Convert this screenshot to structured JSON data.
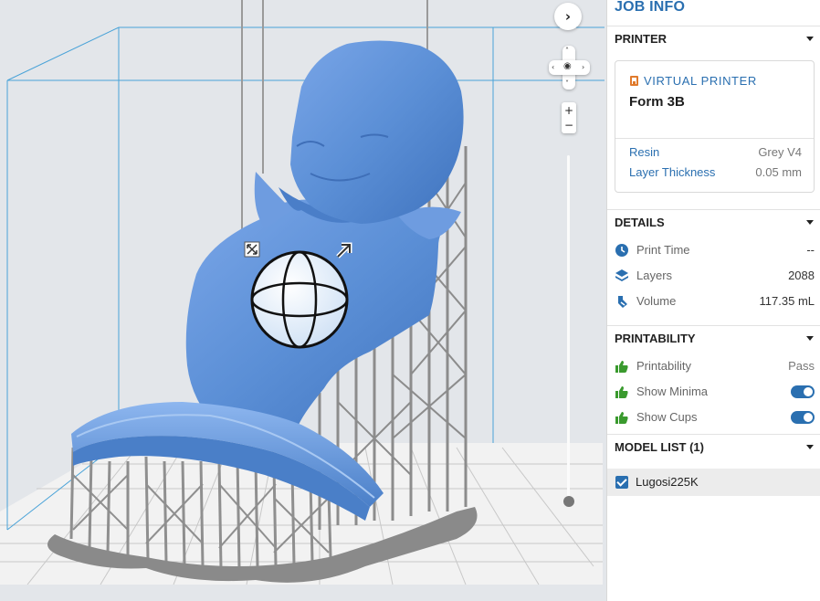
{
  "viewport": {
    "collapse_icon": "chevron-right-icon",
    "zoom_in": "+",
    "zoom_out": "−",
    "zoom_level": 0.05
  },
  "panel": {
    "title": "JOB INFO",
    "printer": {
      "header": "PRINTER",
      "virtual_label": "VIRTUAL PRINTER",
      "model": "Form 3B",
      "resin_label": "Resin",
      "resin_value": "Grey V4",
      "layer_label": "Layer Thickness",
      "layer_value": "0.05 mm"
    },
    "details": {
      "header": "DETAILS",
      "print_time_label": "Print Time",
      "print_time_value": "--",
      "layers_label": "Layers",
      "layers_value": "2088",
      "volume_label": "Volume",
      "volume_value": "117.35 mL"
    },
    "printability": {
      "header": "PRINTABILITY",
      "printability_label": "Printability",
      "printability_value": "Pass",
      "minima_label": "Show Minima",
      "minima_on": true,
      "cups_label": "Show Cups",
      "cups_on": true
    },
    "model_list": {
      "header": "MODEL LIST (1)",
      "items": [
        {
          "name": "Lugosi225K",
          "checked": true
        }
      ]
    }
  },
  "colors": {
    "accent": "#2a6fb0",
    "model_blue": "#5b8fd6",
    "support_grey": "#9a9a9a",
    "pass_green": "#3a9a2e",
    "printer_orange": "#e07a2c"
  }
}
